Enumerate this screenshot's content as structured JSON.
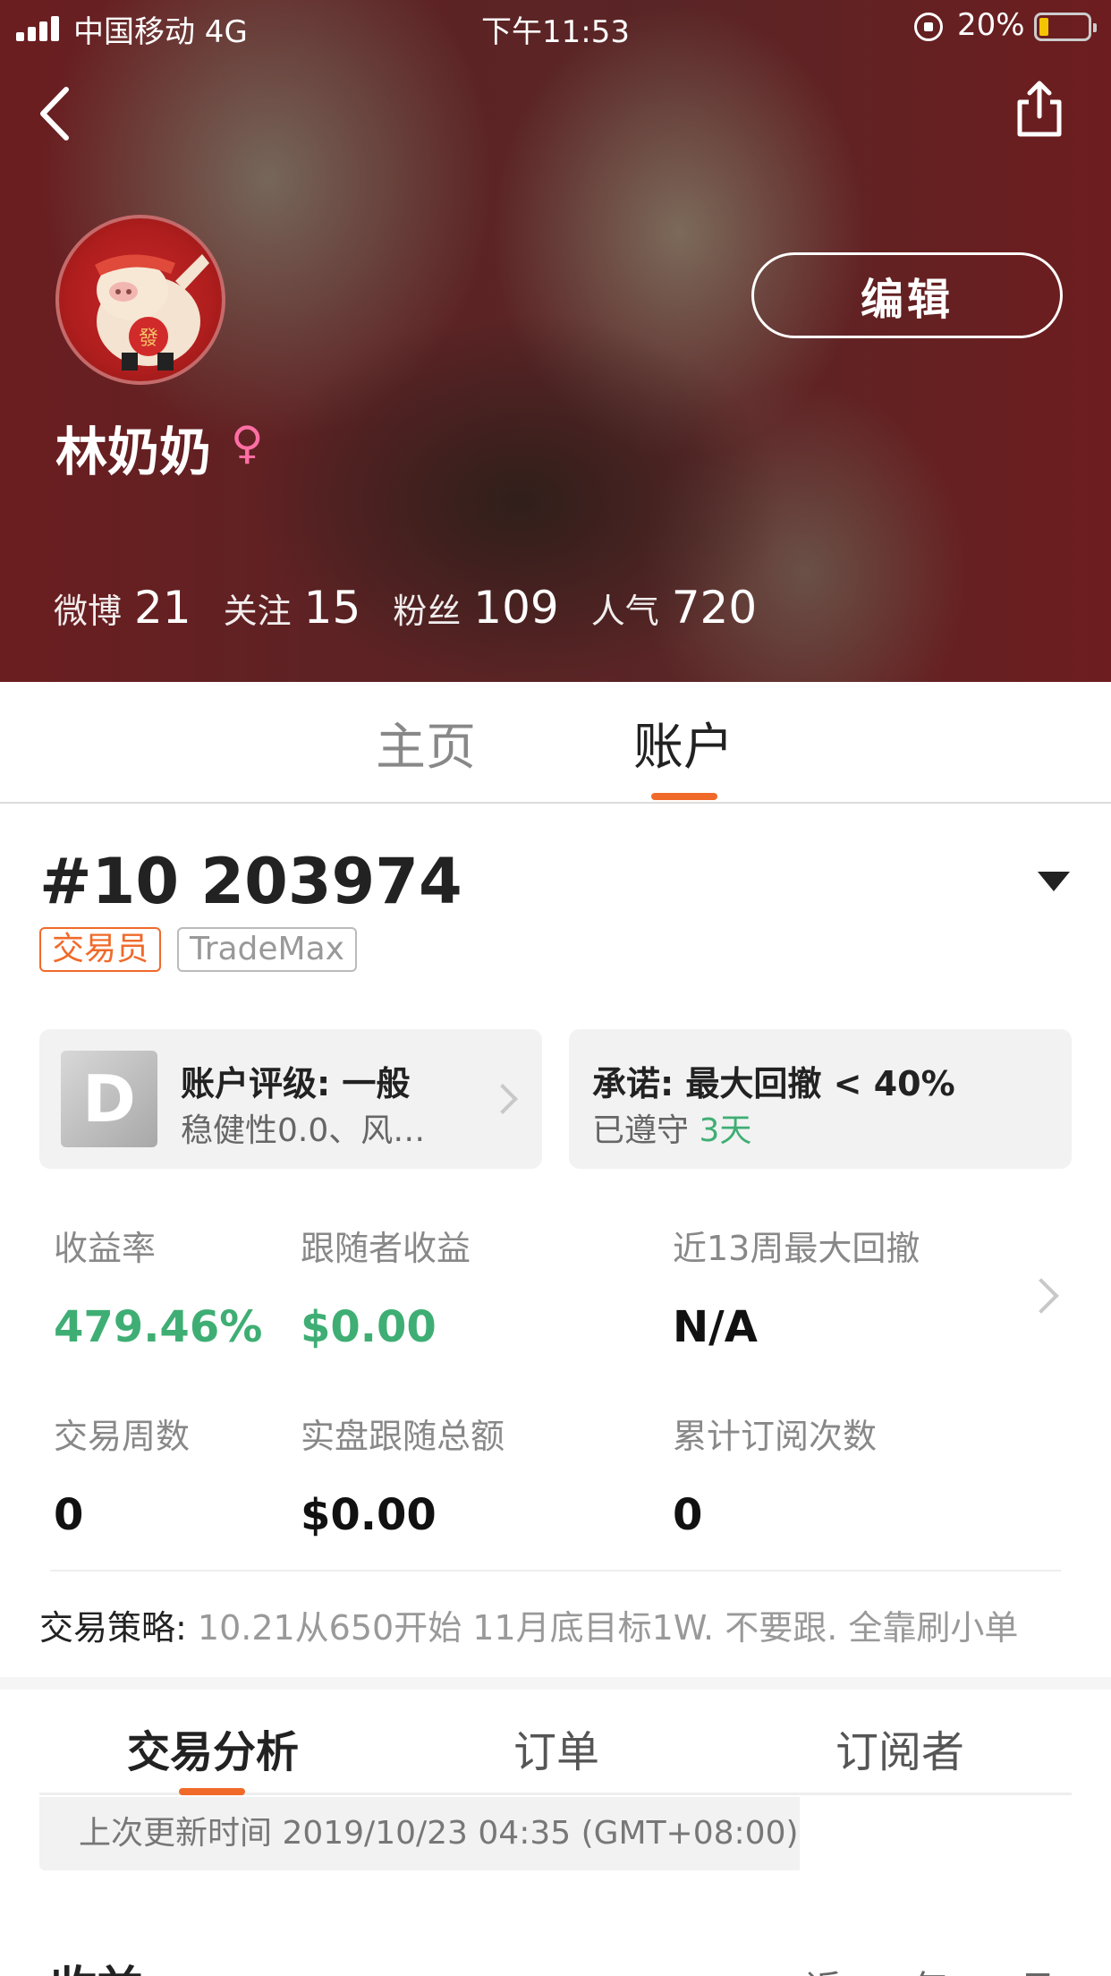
{
  "status_bar": {
    "carrier": "中国移动 4G",
    "time": "下午11:53",
    "battery": "20%"
  },
  "profile": {
    "name": "林奶奶",
    "gender_symbol": "♀",
    "edit_label": "编辑",
    "avatar_text": "發",
    "stats": [
      {
        "label": "微博",
        "value": "21"
      },
      {
        "label": "关注",
        "value": "15"
      },
      {
        "label": "粉丝",
        "value": "109"
      },
      {
        "label": "人气",
        "value": "720"
      }
    ]
  },
  "main_tabs": {
    "home": "主页",
    "account": "账户"
  },
  "account": {
    "number": "#10 203974",
    "tags": {
      "role": "交易员",
      "platform": "TradeMax"
    },
    "rating_card": {
      "grade": "D",
      "title": "账户评级: 一般",
      "subtitle": "稳健性0.0、风…"
    },
    "promise_card": {
      "title": "承诺: 最大回撤 < 40%",
      "subtitle_prefix": "已遵守",
      "days": "3天"
    },
    "metrics": {
      "return_rate": {
        "label": "收益率",
        "value": "479.46%"
      },
      "follower_profit": {
        "label": "跟随者收益",
        "value": "$0.00"
      },
      "max_drawdown": {
        "label": "近13周最大回撤",
        "value": "N/A"
      },
      "trading_weeks": {
        "label": "交易周数",
        "value": "0"
      },
      "live_follow_total": {
        "label": "实盘跟随总额",
        "value": "$0.00"
      },
      "subscription_count": {
        "label": "累计订阅次数",
        "value": "0"
      }
    },
    "strategy": {
      "label": "交易策略:",
      "value": " 10.21从650开始 11月底目标1W. 不要跟. 全靠刷小单"
    }
  },
  "sub_tabs": {
    "analysis": "交易分析",
    "orders": "订单",
    "subscribers": "订阅者"
  },
  "update": {
    "text": "上次更新时间 2019/10/23 04:35 (GMT+08:00)"
  },
  "section": {
    "title": "收益",
    "range": "近一年一日"
  },
  "colors": {
    "accent": "#f06a2a",
    "positive": "#3fae74",
    "hero_bg": "#6b1e20"
  }
}
